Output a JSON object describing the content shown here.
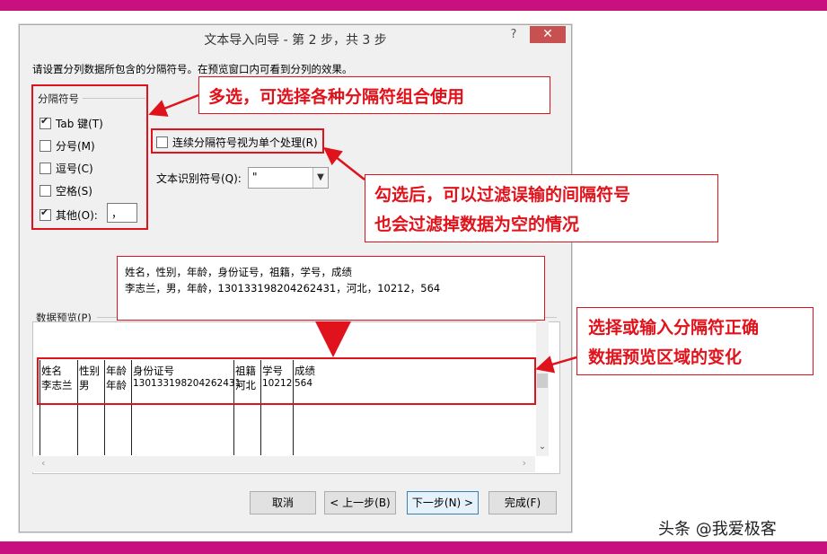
{
  "dialog": {
    "title": "文本导入向导 - 第 2 步，共 3 步",
    "help_label": "?",
    "close_label": "✕",
    "instruction": "请设置分列数据所包含的分隔符号。在预览窗口内可看到分列的效果。"
  },
  "delimiters": {
    "group_label": "分隔符号",
    "items": [
      {
        "label": "Tab 键(T)",
        "checked": true
      },
      {
        "label": "分号(M)",
        "checked": false
      },
      {
        "label": "逗号(C)",
        "checked": false
      },
      {
        "label": "空格(S)",
        "checked": false
      },
      {
        "label": "其他(O):",
        "checked": true
      }
    ],
    "other_value": "，"
  },
  "options": {
    "consecutive_label": "连续分隔符号视为单个处理(R)",
    "consecutive_checked": false,
    "text_qualifier_label": "文本识别符号(Q):",
    "text_qualifier_value": "\""
  },
  "sample": {
    "line1": "姓名，性别，年龄，身份证号，祖籍，学号，成绩",
    "line2": "李志兰，男，年龄，130133198204262431，河北，10212，564"
  },
  "preview": {
    "group_label": "数据预览(P)",
    "columns": [
      {
        "header": "姓名",
        "value": "李志兰"
      },
      {
        "header": "性别",
        "value": "男"
      },
      {
        "header": "年龄",
        "value": "年龄"
      },
      {
        "header": "身份证号",
        "value": "130133198204262431"
      },
      {
        "header": "祖籍",
        "value": "河北"
      },
      {
        "header": "学号",
        "value": "10212"
      },
      {
        "header": "成绩",
        "value": "564"
      }
    ]
  },
  "buttons": {
    "cancel": "取消",
    "back": "< 上一步(B)",
    "next": "下一步(N) >",
    "finish": "完成(F)"
  },
  "annotations": {
    "multi_select": "多选，可选择各种分隔符组合使用",
    "filter_line1": "勾选后，可以过滤误输的间隔符号",
    "filter_line2": "也会过滤掉数据为空的情况",
    "preview_line1": "选择或输入分隔符正确",
    "preview_line2": "数据预览区域的变化"
  },
  "watermark": "头条 @我爱极客",
  "colors": {
    "accent_bar": "#c9107f",
    "annotation_red": "#e0121b",
    "close_button": "#c75050"
  }
}
